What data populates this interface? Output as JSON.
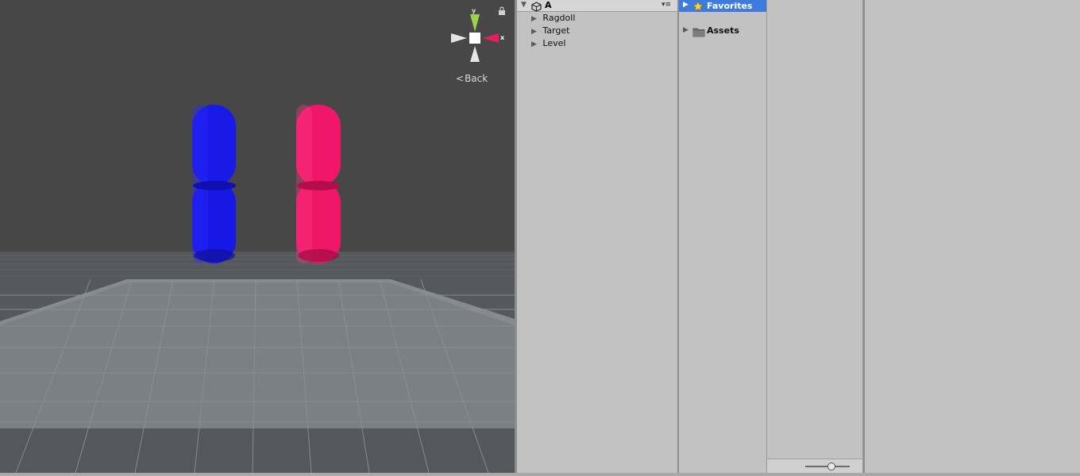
{
  "scene_view": {
    "gizmo": {
      "y_label": "y",
      "x_label": "x",
      "back_label": "Back",
      "lock_icon": "lock-icon",
      "colors": {
        "y": "#9bd24e",
        "x": "#e8205a",
        "cone": "#e6e6e6"
      }
    },
    "objects": [
      {
        "name": "blue-capsules",
        "color": "#1a1af0"
      },
      {
        "name": "pink-capsules",
        "color": "#f0186a"
      }
    ],
    "colors": {
      "sky": "#474747",
      "ground": "#5d6066",
      "plane": "#7c8088",
      "grid": "#8a8e95"
    }
  },
  "hierarchy": {
    "scene_name": "A",
    "unity_icon": "unity-logo-icon",
    "menu_icon": "options-menu-icon",
    "items": [
      {
        "label": "Ragdoll"
      },
      {
        "label": "Target"
      },
      {
        "label": "Level"
      }
    ]
  },
  "project": {
    "favorites_label": "Favorites",
    "assets_label": "Assets",
    "accent": "#3e7bde"
  }
}
